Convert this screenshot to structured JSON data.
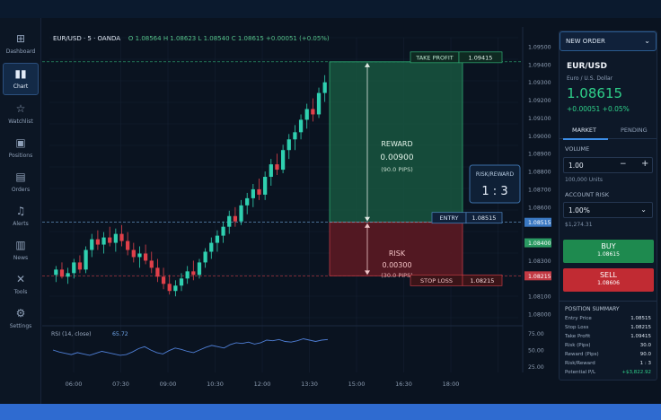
{
  "sidebar": {
    "items": [
      {
        "label": "Dashboard",
        "icon": "grid-icon",
        "glyph": "⊞",
        "active": false
      },
      {
        "label": "Chart",
        "icon": "candlestick-icon",
        "glyph": "▮▮",
        "active": true
      },
      {
        "label": "Watchlist",
        "icon": "star-icon",
        "glyph": "☆",
        "active": false
      },
      {
        "label": "Positions",
        "icon": "briefcase-icon",
        "glyph": "▣",
        "active": false
      },
      {
        "label": "Orders",
        "icon": "document-icon",
        "glyph": "▤",
        "active": false
      },
      {
        "label": "Alerts",
        "icon": "bell-icon",
        "glyph": "♫",
        "active": false
      },
      {
        "label": "News",
        "icon": "newspaper-icon",
        "glyph": "▥",
        "active": false
      },
      {
        "label": "Tools",
        "icon": "tools-icon",
        "glyph": "✕",
        "active": false
      },
      {
        "label": "Settings",
        "icon": "gear-icon",
        "glyph": "⚙",
        "active": false
      }
    ]
  },
  "chart": {
    "symbol": "EUR/USD · 5 · OANDA",
    "ohlc": "O 1.08564  H 1.08623  L 1.08540  C 1.08615  +0.00051 (+0.05%)",
    "take_profit_label": "TAKE PROFIT",
    "take_profit_value": "1.09415",
    "entry_label": "ENTRY",
    "entry_value": "1.08515",
    "stop_loss_label": "STOP LOSS",
    "stop_loss_value": "1.08215",
    "reward_title": "REWARD",
    "reward_value": "0.00900",
    "reward_pips": "(90.0 PIPS)",
    "risk_title": "RISK",
    "risk_value": "0.00300",
    "risk_pips": "(30.0 PIPS)",
    "rr_title": "RISK/REWARD",
    "rr_value": "1 : 3",
    "rsi_label": "RSI (14, close)",
    "rsi_value": "65.72",
    "current_price_tag": "1.08400",
    "colors": {
      "up": "#2fd0b0",
      "down": "#e0404a",
      "reward": "#1f7a55",
      "risk": "#7a1d24"
    }
  },
  "chart_data": [
    {
      "type": "candlestick",
      "title": "EUR/USD · 5 · OANDA",
      "y_ticks": [
        "1.09500",
        "1.09400",
        "1.09300",
        "1.09200",
        "1.09100",
        "1.09000",
        "1.08900",
        "1.08800",
        "1.08700",
        "1.08600",
        "1.08515",
        "1.08400",
        "1.08300",
        "1.08215",
        "1.08100",
        "1.08000"
      ],
      "x_ticks": [
        "06:00",
        "07:30",
        "09:00",
        "10:30",
        "12:00",
        "13:30",
        "15:00",
        "16:30",
        "18:00"
      ],
      "ylim": [
        1.0795,
        1.0955
      ],
      "candles": [
        [
          1.0822,
          1.0827,
          1.0818,
          1.0825
        ],
        [
          1.0825,
          1.0829,
          1.082,
          1.0821
        ],
        [
          1.0821,
          1.0826,
          1.0817,
          1.0823
        ],
        [
          1.0823,
          1.0831,
          1.082,
          1.0829
        ],
        [
          1.0829,
          1.0833,
          1.0823,
          1.0825
        ],
        [
          1.0825,
          1.0838,
          1.0823,
          1.0836
        ],
        [
          1.0836,
          1.0845,
          1.0832,
          1.0842
        ],
        [
          1.0842,
          1.0847,
          1.0836,
          1.0839
        ],
        [
          1.0839,
          1.0846,
          1.0834,
          1.0843
        ],
        [
          1.0843,
          1.0849,
          1.0838,
          1.084
        ],
        [
          1.084,
          1.0848,
          1.0835,
          1.0845
        ],
        [
          1.0845,
          1.085,
          1.0838,
          1.0841
        ],
        [
          1.0841,
          1.0846,
          1.0833,
          1.0836
        ],
        [
          1.0836,
          1.084,
          1.0829,
          1.0832
        ],
        [
          1.0832,
          1.0838,
          1.0826,
          1.0834
        ],
        [
          1.0834,
          1.0839,
          1.0828,
          1.083
        ],
        [
          1.083,
          1.0835,
          1.0823,
          1.0826
        ],
        [
          1.0826,
          1.0831,
          1.0818,
          1.0821
        ],
        [
          1.0821,
          1.0826,
          1.0814,
          1.0817
        ],
        [
          1.0817,
          1.0822,
          1.0811,
          1.0813
        ],
        [
          1.0813,
          1.0819,
          1.081,
          1.0816
        ],
        [
          1.0816,
          1.0823,
          1.0813,
          1.082
        ],
        [
          1.082,
          1.0827,
          1.0817,
          1.0824
        ],
        [
          1.0824,
          1.083,
          1.0819,
          1.0822
        ],
        [
          1.0822,
          1.0831,
          1.082,
          1.0829
        ],
        [
          1.0829,
          1.0837,
          1.0826,
          1.0835
        ],
        [
          1.0835,
          1.0843,
          1.0831,
          1.084
        ],
        [
          1.084,
          1.0847,
          1.0835,
          1.0844
        ],
        [
          1.0844,
          1.0852,
          1.084,
          1.0849
        ],
        [
          1.0849,
          1.0858,
          1.0845,
          1.0855
        ],
        [
          1.0855,
          1.086,
          1.0849,
          1.0852
        ],
        [
          1.0852,
          1.0864,
          1.085,
          1.0861
        ],
        [
          1.0861,
          1.0868,
          1.0856,
          1.0865
        ],
        [
          1.0865,
          1.0873,
          1.086,
          1.087
        ],
        [
          1.087,
          1.0876,
          1.0864,
          1.0867
        ],
        [
          1.0867,
          1.088,
          1.0864,
          1.0877
        ],
        [
          1.0877,
          1.0887,
          1.0872,
          1.0884
        ],
        [
          1.0884,
          1.089,
          1.0878,
          1.0881
        ],
        [
          1.0881,
          1.0895,
          1.0879,
          1.0892
        ],
        [
          1.0892,
          1.0901,
          1.0887,
          1.0898
        ],
        [
          1.0898,
          1.0906,
          1.0892,
          1.0902
        ],
        [
          1.0902,
          1.0912,
          1.0898,
          1.0909
        ],
        [
          1.0909,
          1.0918,
          1.0904,
          1.0915
        ],
        [
          1.0915,
          1.0921,
          1.0908,
          1.0912
        ],
        [
          1.0912,
          1.0927,
          1.091,
          1.0924
        ],
        [
          1.0924,
          1.0934,
          1.0919,
          1.093
        ]
      ],
      "rsi": {
        "y_ticks": [
          "75.00",
          "50.00",
          "25.00"
        ],
        "ylim": [
          20,
          80
        ],
        "values": [
          50,
          47,
          45,
          43,
          46,
          44,
          42,
          45,
          48,
          46,
          44,
          42,
          43,
          47,
          52,
          55,
          50,
          46,
          44,
          49,
          53,
          51,
          48,
          46,
          50,
          54,
          57,
          55,
          53,
          58,
          61,
          60,
          62,
          59,
          61,
          65,
          64,
          66,
          63,
          62,
          64,
          67,
          65,
          63,
          65,
          66
        ]
      }
    }
  ],
  "panel": {
    "order_type": "NEW ORDER",
    "pair": "EUR/USD",
    "pair_name": "Euro / U.S. Dollar",
    "price": "1.08615",
    "change": "+0.00051  +0.05%",
    "tabs": [
      "MARKET",
      "PENDING"
    ],
    "volume_label": "VOLUME",
    "volume_value": "1.00",
    "volume_units": "100,000 Units",
    "account_risk_label": "ACCOUNT RISK",
    "account_risk_value": "1.00%",
    "account_risk_amount": "$1,274.31",
    "buy_label": "BUY",
    "buy_price": "1.08615",
    "sell_label": "SELL",
    "sell_price": "1.08606",
    "summary_title": "POSITION SUMMARY",
    "summary": [
      {
        "label": "Entry Price",
        "value": "1.08515"
      },
      {
        "label": "Stop Loss",
        "value": "1.08215"
      },
      {
        "label": "Take Profit",
        "value": "1.09415"
      },
      {
        "label": "Risk (Pips)",
        "value": "30.0"
      },
      {
        "label": "Reward (Pips)",
        "value": "90.0"
      },
      {
        "label": "Risk/Reward",
        "value": "1 : 3"
      },
      {
        "label": "Potential P/L",
        "value": "+$3,822.92"
      }
    ]
  }
}
